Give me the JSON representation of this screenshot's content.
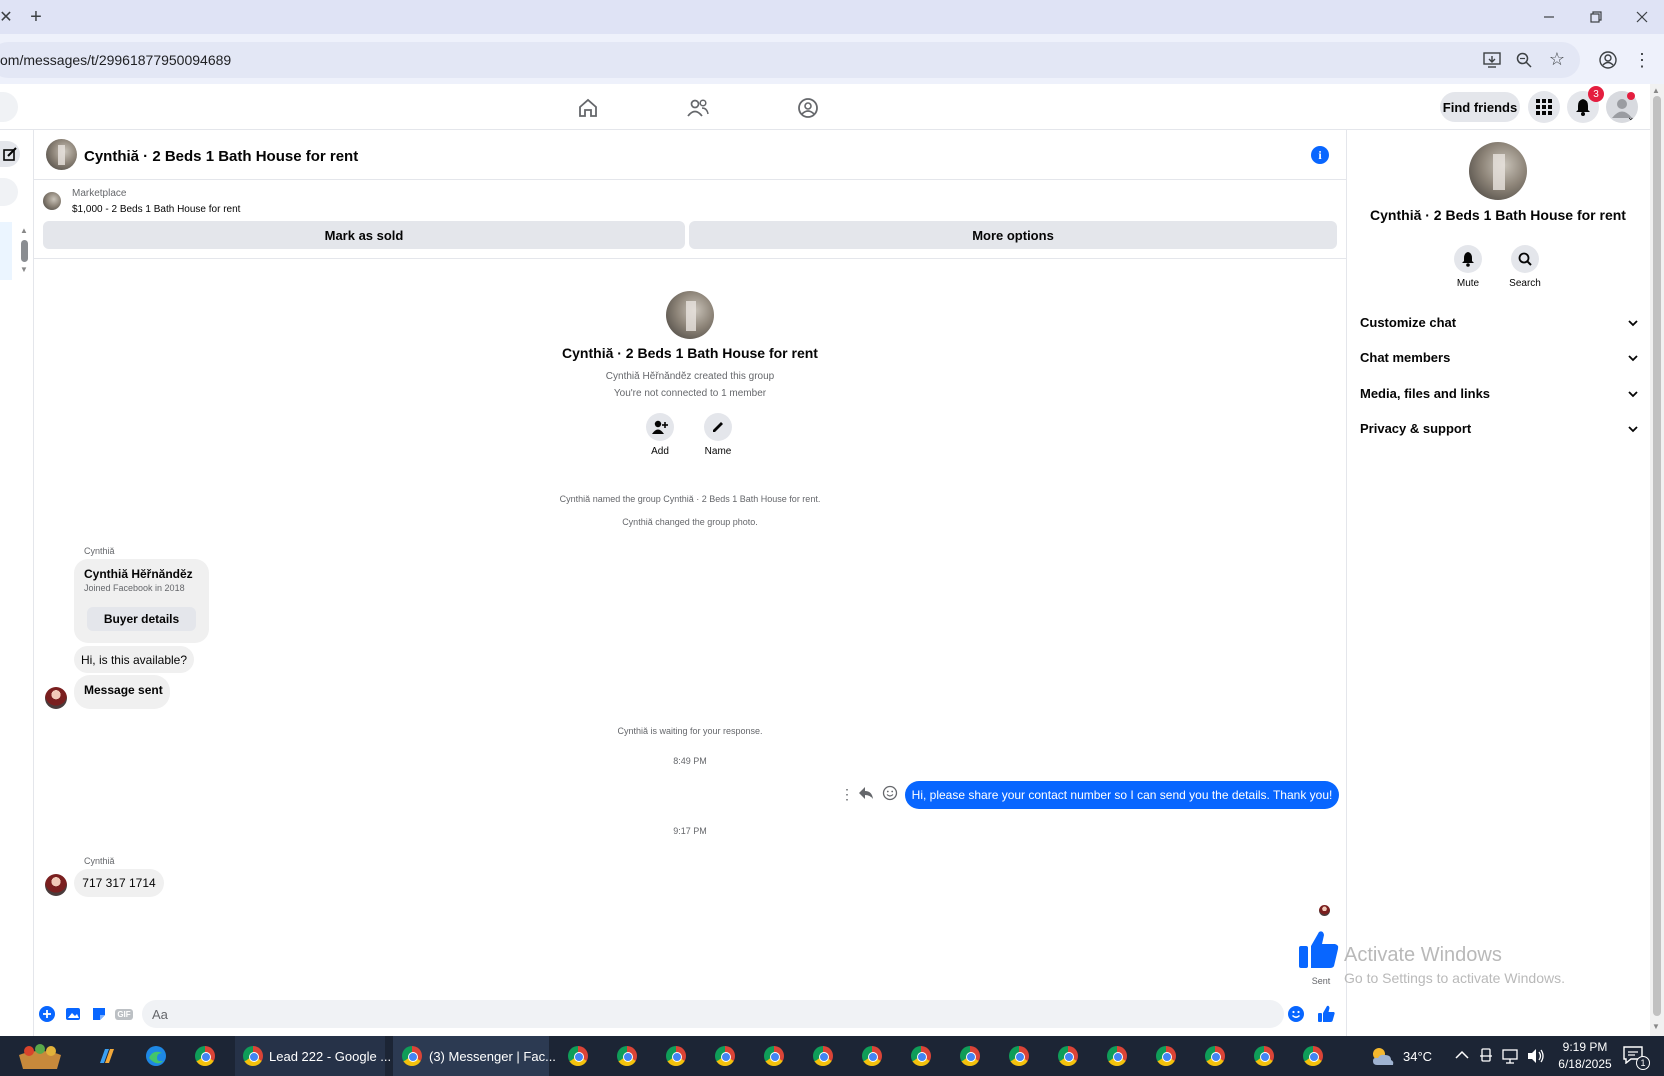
{
  "browser": {
    "url": "om/messages/t/29961877950094689",
    "new_tab_symbol": "+",
    "close_tab_symbol": "✕"
  },
  "fbnav": {
    "find_friends": "Find friends",
    "notification_count": "3"
  },
  "chat": {
    "title": "Cynthiă · 2 Beds 1 Bath House for rent",
    "info_symbol": "i",
    "marketplace_label": "Marketplace",
    "listing": "$1,000 - 2 Beds 1 Bath House for rent",
    "mark_as_sold": "Mark as sold",
    "more_options": "More options"
  },
  "group_info": {
    "name": "Cynthiă · 2 Beds 1 Bath House for rent",
    "created_by": "Cynthiă Hĕřnăndĕz created this group",
    "not_connected": "You're not connected to 1 member",
    "add_label": "Add",
    "name_label": "Name",
    "event_named": "Cynthiă named the group Cynthiă · 2 Beds 1 Bath House for rent.",
    "event_photo": "Cynthiă changed the group photo."
  },
  "messages": {
    "sender1": "Cynthiă",
    "buyer_name": "Cynthiă Hĕřnăndĕz",
    "buyer_joined": "Joined Facebook in 2018",
    "buyer_details": "Buyer details",
    "msg_available": "Hi, is this available?",
    "msg_sent_label": "Message sent",
    "waiting": "Cynthiă is waiting for your response.",
    "time1": "8:49 PM",
    "outgoing": "Hi, please share your contact number so I can send you the details. Thank you!",
    "time2": "9:17 PM",
    "sender2": "Cynthiă",
    "phone": "717 317 1714",
    "sent_status": "Sent"
  },
  "composer": {
    "placeholder": "Aa",
    "gif_label": "GIF"
  },
  "right_panel": {
    "title": "Cynthiă · 2 Beds 1 Bath House for rent",
    "mute": "Mute",
    "search": "Search",
    "items": [
      "Customize chat",
      "Chat members",
      "Media, files and links",
      "Privacy & support"
    ]
  },
  "watermark": {
    "line1": "Activate Windows",
    "line2": "Go to Settings to activate Windows."
  },
  "taskbar": {
    "app1": "Lead 222 - Google ...",
    "app2": "(3) Messenger | Fac...",
    "weather": "34°C",
    "time": "9:19 PM",
    "date": "6/18/2025",
    "notif_count": "1"
  },
  "colors": {
    "accent": "#0866ff",
    "bubble_gray": "#f0f0f0",
    "taskbar": "#1c2535"
  }
}
